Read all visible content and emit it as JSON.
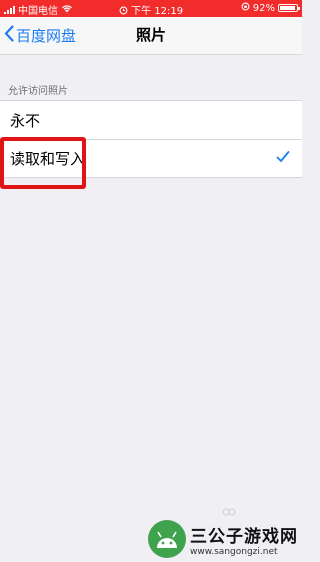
{
  "status_bar": {
    "carrier": "中国电信",
    "time": "下午 12:19",
    "battery_text": "92%",
    "battery_level": 0.92
  },
  "nav": {
    "back_label": "百度网盘",
    "title": "照片"
  },
  "section": {
    "header": "允许访问照片",
    "options": [
      {
        "label": "永不",
        "selected": false
      },
      {
        "label": "读取和写入",
        "selected": true
      }
    ]
  },
  "watermark": {
    "title": "三公子游戏网",
    "url": "www.sangongzi.net"
  },
  "colors": {
    "status_bar": "#f22b2b",
    "accent": "#1c7cf4",
    "highlight": "#e01414",
    "background": "#efeff4"
  },
  "icons": [
    "signal-icon",
    "wifi-icon",
    "alarm-icon",
    "lock-rotation-icon",
    "battery-icon",
    "back-chevron-icon",
    "checkmark-icon",
    "android-icon"
  ]
}
